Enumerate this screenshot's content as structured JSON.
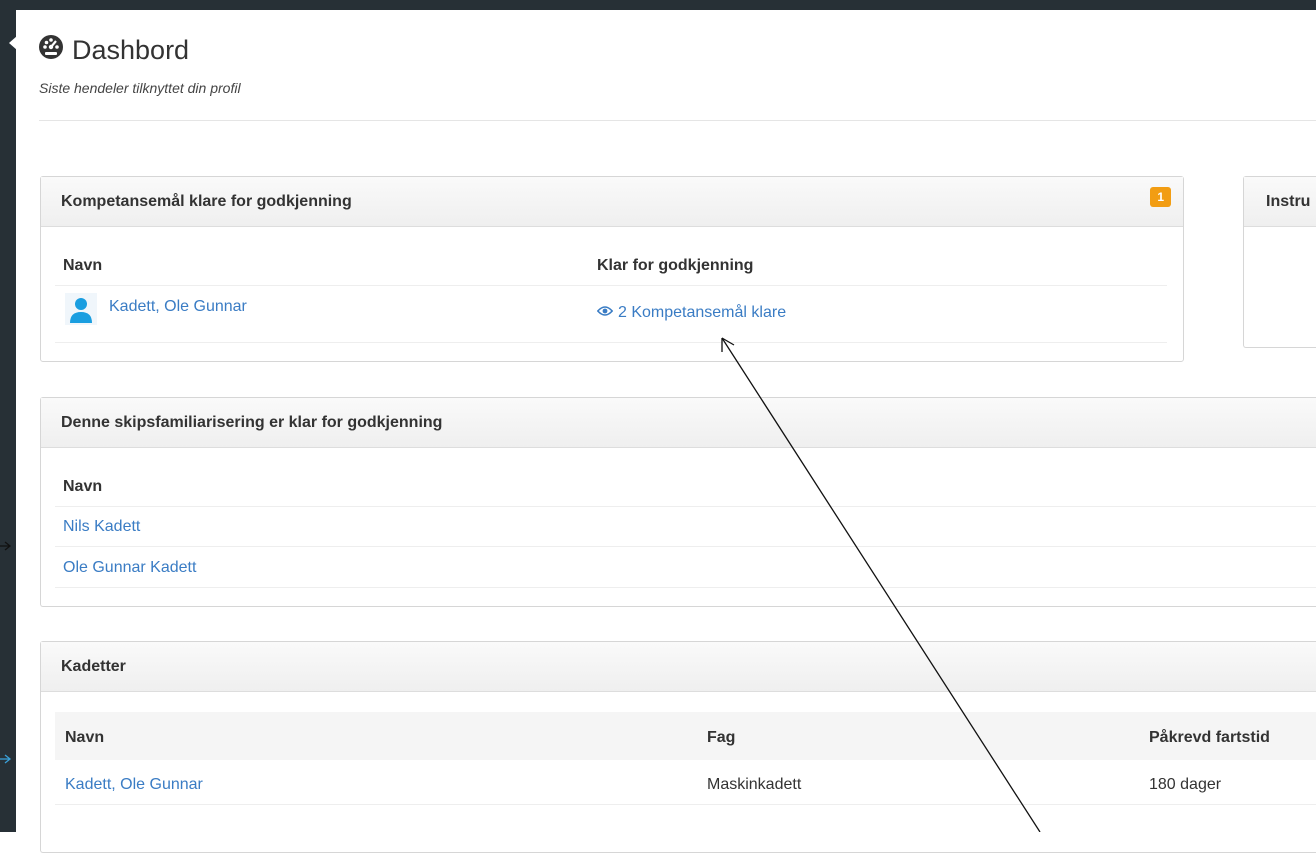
{
  "header": {
    "title": "Dashbord",
    "subtitle": "Siste hendeler tilknyttet din profil"
  },
  "panel1": {
    "title": "Kompetansemål klare for godkjenning",
    "badge": "1",
    "col_name": "Navn",
    "col_ready": "Klar for godkjenning",
    "row": {
      "name": "Kadett, Ole Gunnar",
      "ready": "2 Kompetansemål klare"
    }
  },
  "panel_right": {
    "title": "Instru"
  },
  "panel2": {
    "title": "Denne skipsfamiliarisering er klar for godkjenning",
    "col_name": "Navn",
    "rows": [
      "Nils Kadett",
      "Ole Gunnar Kadett"
    ]
  },
  "panel3": {
    "title": "Kadetter",
    "columns": [
      "Navn",
      "Fag",
      "Påkrevd fartstid"
    ],
    "rows": [
      [
        "Kadett, Ole Gunnar",
        "Maskinkadett",
        "180 dager"
      ]
    ]
  },
  "colors": {
    "link": "#3a7cc4",
    "badge": "#f29d13",
    "sidebar": "#273036"
  }
}
